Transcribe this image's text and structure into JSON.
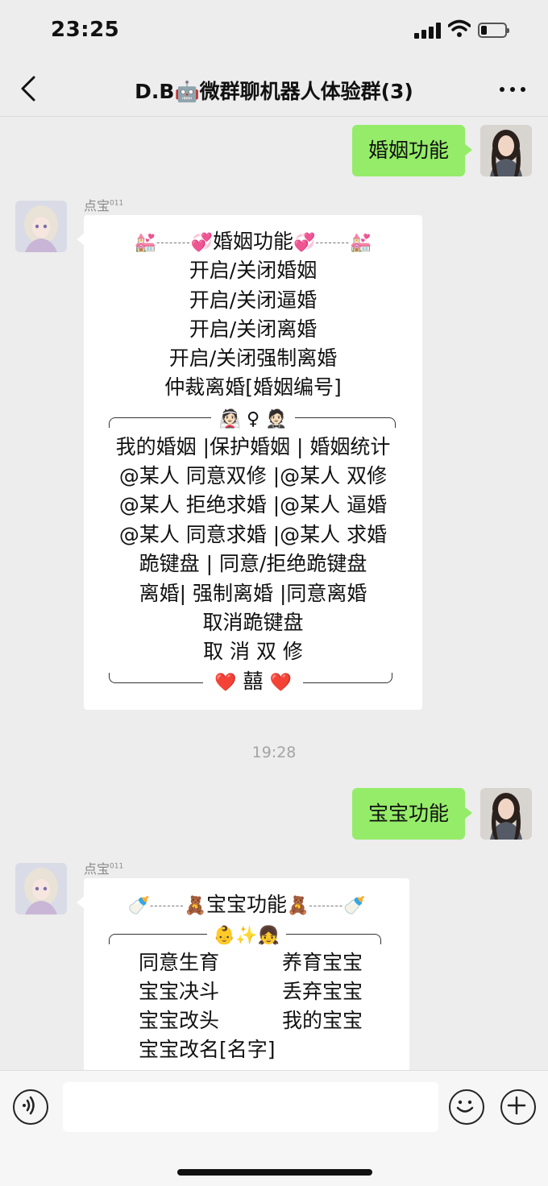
{
  "status_bar": {
    "time": "23:25"
  },
  "header": {
    "title": "D.B🤖微群聊机器人体验群(3)"
  },
  "messages": {
    "m1": {
      "text": "婚姻功能"
    },
    "m2": {
      "sender": "点宝",
      "sender_sup": "011",
      "title_line": "婚姻功能",
      "lines": [
        "开启/关闭婚姻",
        "开启/关闭逼婚",
        "开启/关闭离婚",
        "开启/关闭强制离婚",
        "仲裁离婚[婚姻编号]"
      ],
      "divider_symbol": "♀",
      "lines2": [
        "我的婚姻 |保护婚姻 | 婚姻统计",
        "@某人 同意双修 |@某人 双修",
        "@某人 拒绝求婚 |@某人 逼婚",
        "@某人 同意求婚 |@某人 求婚",
        "跪键盘 | 同意/拒绝跪键盘",
        "离婚| 强制离婚 |同意离婚",
        "取消跪键盘",
        "取 消 双 修"
      ],
      "footer_char": "囍"
    },
    "timestamp": "19:28",
    "m3": {
      "text": "宝宝功能"
    },
    "m4": {
      "sender": "点宝",
      "sender_sup": "011",
      "title_line": "宝宝功能",
      "grid": [
        [
          "同意生育",
          "养育宝宝"
        ],
        [
          "宝宝决斗",
          "丢弃宝宝"
        ],
        [
          "宝宝改头",
          "我的宝宝"
        ],
        [
          "宝宝改名[名字]",
          ""
        ]
      ]
    }
  },
  "colors": {
    "outgoing_bubble": "#95ec69",
    "background": "#ededed"
  },
  "icons": [
    "back-icon",
    "more-icon",
    "voice-icon",
    "emoji-icon",
    "plus-icon"
  ]
}
